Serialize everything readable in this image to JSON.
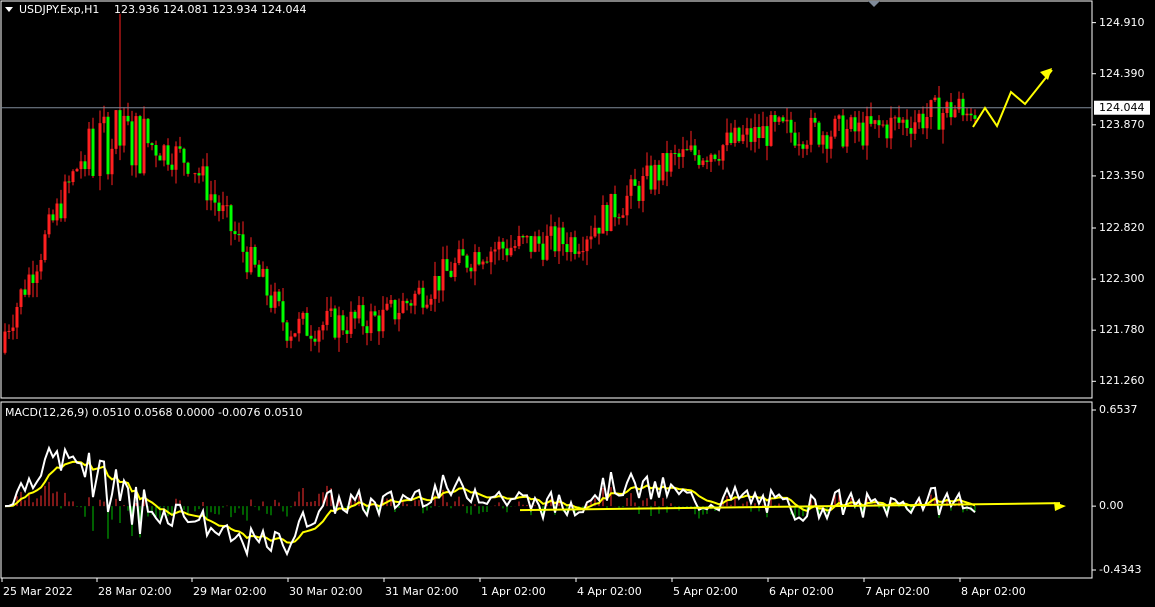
{
  "header": {
    "symbol_label": "USDJPY.Exp,H1",
    "ohlc": "123.936 124.081 123.934 124.044"
  },
  "macd_label": "MACD(12,26,9) 0.0510 0.0568 0.0000 -0.0076 0.0510",
  "colors": {
    "bull": "#00ff00",
    "bear": "#ff0000",
    "wick": "#ff2020",
    "axis": "#ffffff",
    "price_line": "#7f8a99",
    "macd_line": "#ffffff",
    "signal_line": "#ffff00",
    "arrow": "#ffff00",
    "hist_pos": "#ff3030",
    "hist_neg": "#00c000"
  },
  "chart_data": [
    {
      "type": "candlestick",
      "title": "USDJPY.Exp,H1",
      "current_price": "124.044",
      "y_ticks": [
        "124.910",
        "124.390",
        "123.870",
        "123.350",
        "122.820",
        "122.300",
        "121.780",
        "121.260"
      ],
      "ylim": [
        121.09,
        125.13
      ],
      "x_ticks": [
        "25 Mar 2022",
        "28 Mar 02:00",
        "29 Mar 02:00",
        "30 Mar 02:00",
        "31 Mar 02:00",
        "1 Apr 02:00",
        "4 Apr 02:00",
        "5 Apr 02:00",
        "6 Apr 02:00",
        "7 Apr 02:00",
        "8 Apr 02:00"
      ],
      "key_points": [
        {
          "label": "25 Mar 2022",
          "close": 121.7
        },
        {
          "label": "28 Mar 02:00",
          "close": 123.9,
          "high": 125.0
        },
        {
          "label": "29 Mar 02:00",
          "close": 123.5
        },
        {
          "label": "30 Mar 02:00",
          "close": 121.8
        },
        {
          "label": "31 Mar 02:00",
          "close": 121.9
        },
        {
          "label": "1 Apr 02:00",
          "close": 122.6
        },
        {
          "label": "4 Apr 02:00",
          "close": 122.7
        },
        {
          "label": "5 Apr 02:00",
          "close": 123.5
        },
        {
          "label": "6 Apr 02:00",
          "close": 123.8
        },
        {
          "label": "7 Apr 02:00",
          "close": 123.8
        },
        {
          "label": "8 Apr 02:00",
          "close": 124.044
        }
      ],
      "annotation": "projected upward zig-zag arrows after last candle"
    },
    {
      "type": "macd",
      "title": "MACD(12,26,9)",
      "values": {
        "main": 0.051,
        "signal": 0.0568,
        "histogram": 0.0,
        "osma": -0.0076,
        "last": 0.051
      },
      "y_ticks": [
        "0.6537",
        "0.00",
        "-0.4343"
      ],
      "ylim": [
        -0.4343,
        0.6537
      ]
    }
  ]
}
